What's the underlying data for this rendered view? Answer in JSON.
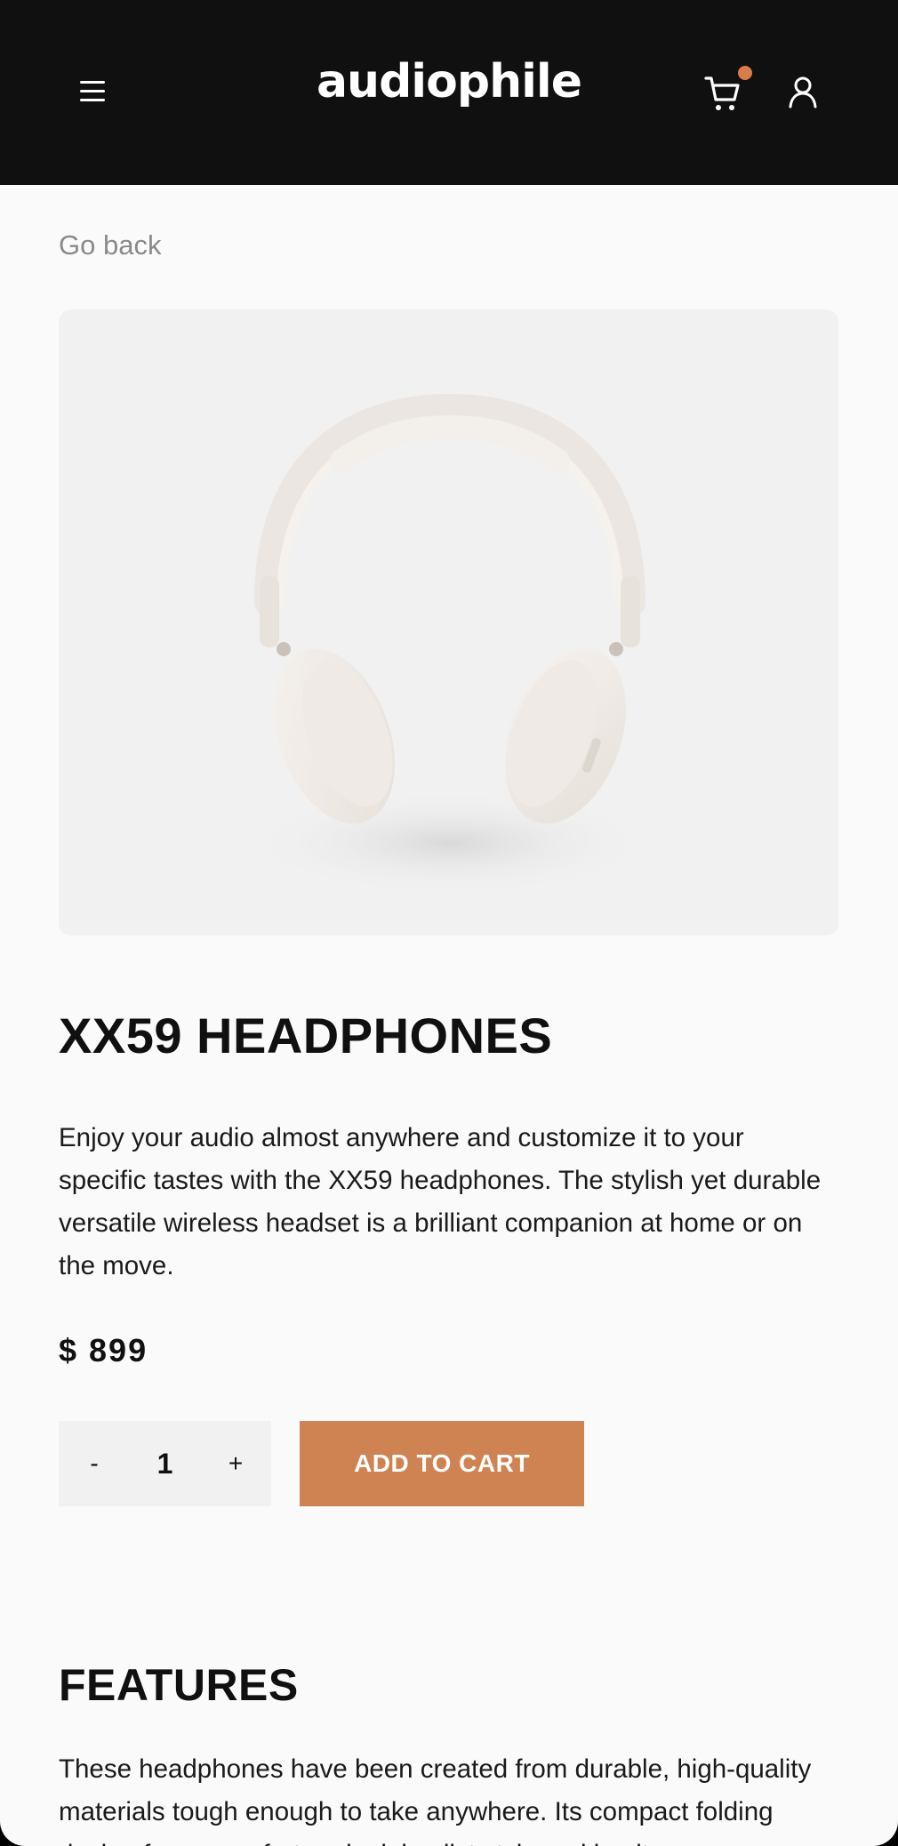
{
  "header": {
    "logo": "audiophile",
    "menu_icon": "hamburger-menu-icon",
    "cart_icon": "shopping-cart-icon",
    "user_icon": "user-icon",
    "cart_badge_color": "#d87d4a"
  },
  "nav": {
    "go_back": "Go back"
  },
  "product": {
    "image_alt": "white-headphones",
    "title": "XX59 HEADPHONES",
    "description": "Enjoy your audio almost anywhere and customize it to your specific tastes with the XX59 headphones. The stylish yet durable versatile wireless headset is a brilliant companion at home or on the move.",
    "price": "$ 899",
    "quantity": {
      "minus": "-",
      "value": "1",
      "plus": "+"
    },
    "add_to_cart": "ADD TO CART"
  },
  "features": {
    "title": "FEATURES",
    "text": "These headphones have been created from durable, high-quality materials tough enough to take anywhere. Its compact folding design fuses comfort and minimalist style making it"
  },
  "colors": {
    "accent": "#d87d4a",
    "header_bg": "#101010",
    "page_bg": "#fafafa"
  }
}
